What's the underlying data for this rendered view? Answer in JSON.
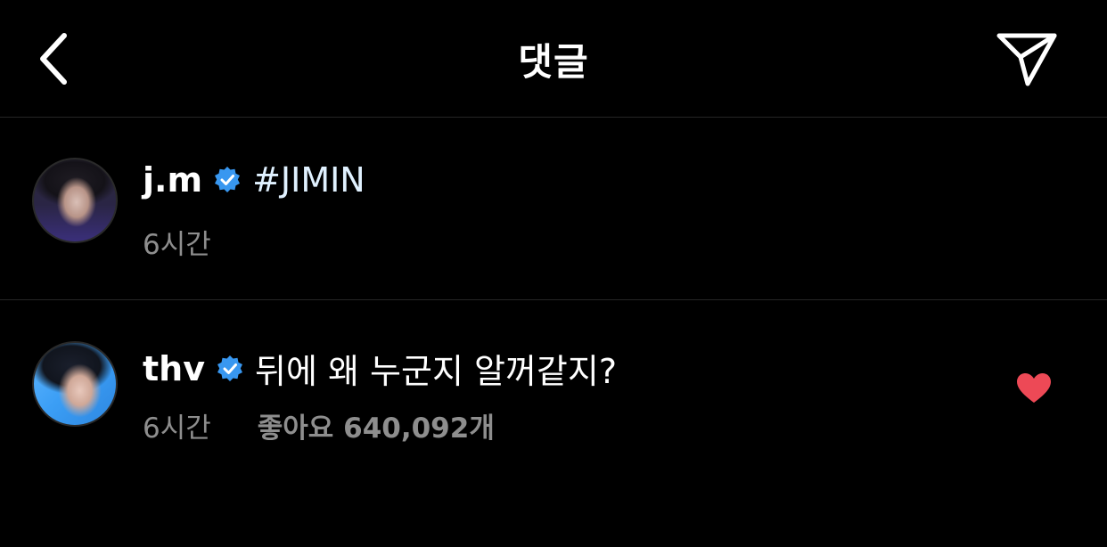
{
  "header": {
    "title": "댓글",
    "back_icon": "chevron-left-icon",
    "share_icon": "paper-plane-icon"
  },
  "comments": [
    {
      "username": "j.m",
      "verified": true,
      "text": "#JIMIN",
      "time": "6시간",
      "likes": ""
    },
    {
      "username": "thv",
      "verified": true,
      "text": "뒤에 왜 누군지 알꺼같지?",
      "time": "6시간",
      "likes": "좋아요 640,092개",
      "liked": true
    }
  ],
  "colors": {
    "background": "#000000",
    "verified": "#3897f0",
    "heart": "#ed4956",
    "secondary_text": "#8e8e8e",
    "divider": "#262626"
  }
}
